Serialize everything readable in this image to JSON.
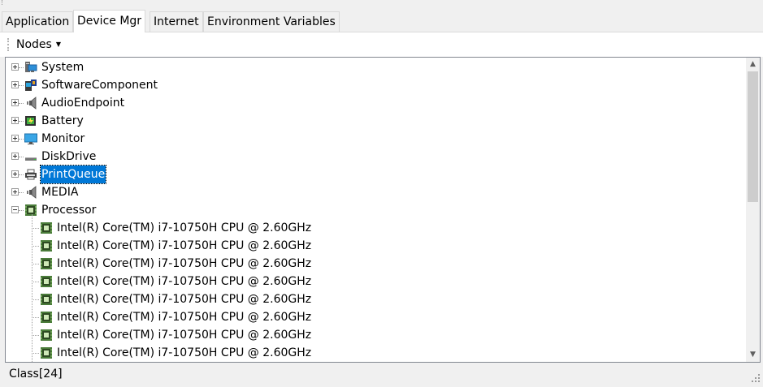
{
  "tabs": [
    {
      "label": "Application",
      "active": false
    },
    {
      "label": "Device Mgr",
      "active": true
    },
    {
      "label": "Internet",
      "active": false
    },
    {
      "label": "Environment Variables",
      "active": false
    }
  ],
  "toolbar": {
    "nodes_label": "Nodes"
  },
  "tree": {
    "nodes": [
      {
        "label": "System",
        "icon": "system-icon",
        "expanded": false
      },
      {
        "label": "SoftwareComponent",
        "icon": "software-component-icon",
        "expanded": false
      },
      {
        "label": "AudioEndpoint",
        "icon": "speaker-icon",
        "expanded": false
      },
      {
        "label": "Battery",
        "icon": "battery-icon",
        "expanded": false
      },
      {
        "label": "Monitor",
        "icon": "monitor-icon",
        "expanded": false
      },
      {
        "label": "DiskDrive",
        "icon": "disk-drive-icon",
        "expanded": false
      },
      {
        "label": "PrintQueue",
        "icon": "printer-icon",
        "expanded": false,
        "selected": true
      },
      {
        "label": "MEDIA",
        "icon": "speaker-icon",
        "expanded": false
      },
      {
        "label": "Processor",
        "icon": "processor-icon",
        "expanded": true,
        "children": [
          "Intel(R) Core(TM) i7-10750H CPU @ 2.60GHz",
          "Intel(R) Core(TM) i7-10750H CPU @ 2.60GHz",
          "Intel(R) Core(TM) i7-10750H CPU @ 2.60GHz",
          "Intel(R) Core(TM) i7-10750H CPU @ 2.60GHz",
          "Intel(R) Core(TM) i7-10750H CPU @ 2.60GHz",
          "Intel(R) Core(TM) i7-10750H CPU @ 2.60GHz",
          "Intel(R) Core(TM) i7-10750H CPU @ 2.60GHz",
          "Intel(R) Core(TM) i7-10750H CPU @ 2.60GHz"
        ]
      }
    ]
  },
  "status": {
    "text": "Class[24]"
  },
  "colors": {
    "selection": "#0078d7",
    "border": "#828790"
  }
}
